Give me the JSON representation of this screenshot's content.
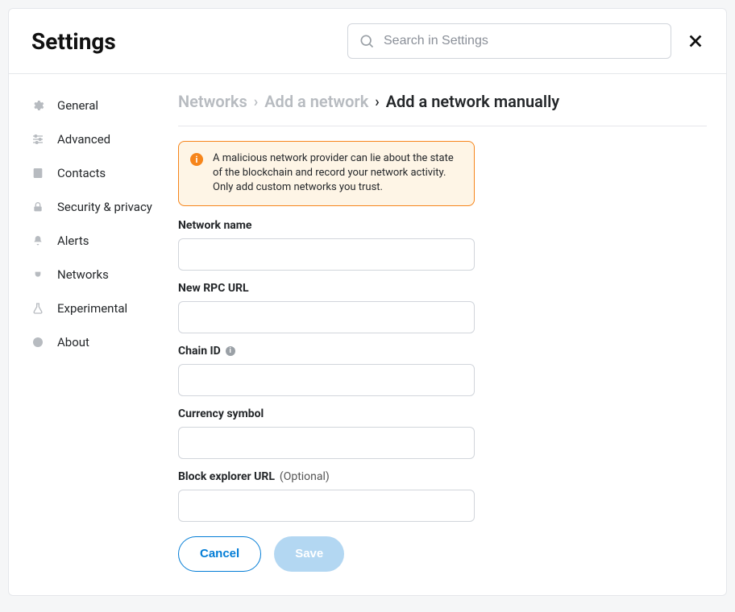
{
  "header": {
    "title": "Settings",
    "search_placeholder": "Search in Settings"
  },
  "sidebar": {
    "items": [
      {
        "id": "general",
        "label": "General",
        "icon": "gear-icon"
      },
      {
        "id": "advanced",
        "label": "Advanced",
        "icon": "sliders-icon"
      },
      {
        "id": "contacts",
        "label": "Contacts",
        "icon": "contacts-icon"
      },
      {
        "id": "security",
        "label": "Security & privacy",
        "icon": "lock-icon"
      },
      {
        "id": "alerts",
        "label": "Alerts",
        "icon": "bell-icon"
      },
      {
        "id": "networks",
        "label": "Networks",
        "icon": "plug-icon"
      },
      {
        "id": "experimental",
        "label": "Experimental",
        "icon": "flask-icon"
      },
      {
        "id": "about",
        "label": "About",
        "icon": "info-icon"
      }
    ]
  },
  "breadcrumb": {
    "crumb1": "Networks",
    "crumb2": "Add a network",
    "current": "Add a network manually"
  },
  "warning": {
    "text": "A malicious network provider can lie about the state of the blockchain and record your network activity. Only add custom networks you trust."
  },
  "form": {
    "network_name": {
      "label": "Network name",
      "value": ""
    },
    "rpc_url": {
      "label": "New RPC URL",
      "value": ""
    },
    "chain_id": {
      "label": "Chain ID",
      "value": ""
    },
    "currency_symbol": {
      "label": "Currency symbol",
      "value": ""
    },
    "block_explorer": {
      "label": "Block explorer URL",
      "optional": "(Optional)",
      "value": ""
    }
  },
  "actions": {
    "cancel": "Cancel",
    "save": "Save"
  }
}
